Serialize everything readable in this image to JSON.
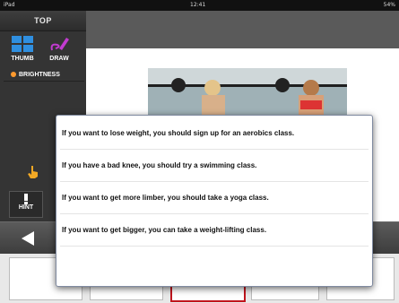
{
  "status_bar": {
    "device": "iPad",
    "time": "12:41",
    "battery": "54%"
  },
  "sidebar": {
    "title": "TOP",
    "tools": [
      {
        "label": "THUMB",
        "icon": "thumbnail-grid-icon"
      },
      {
        "label": "DRAW",
        "icon": "pen-icon"
      }
    ],
    "brightness_label": "BRIGHTNESS",
    "hint_label": "HINT"
  },
  "dialog": {
    "options": [
      "If you want to lose weight, you should sign up for an aerobics class.",
      "If you have a bad knee, you should try a swimming class.",
      "If you want to get more limber, you should take a yoga class.",
      "If you want to get bigger, you can take a weight-lifting class."
    ]
  },
  "colors": {
    "accent": "#c0141c",
    "thumb_icon": "#2f8fe0",
    "draw_icon": "#c23bd0",
    "brightness_icon": "#ff9a2e"
  }
}
